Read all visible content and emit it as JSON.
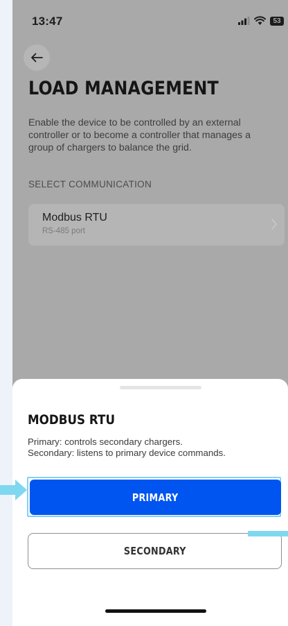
{
  "status_bar": {
    "time": "13:47",
    "battery": "53",
    "icons": [
      "signal-icon",
      "wifi-icon",
      "battery-icon"
    ]
  },
  "header": {
    "back_icon": "arrow-left-icon",
    "title": "LOAD MANAGEMENT",
    "description": "Enable the device to be controlled by an external controller or to become a controller that manages a group of chargers to balance the grid."
  },
  "communication": {
    "section_label": "SELECT COMMUNICATION",
    "option": {
      "title": "Modbus RTU",
      "subtitle": "RS-485 port",
      "icon": "chevron-right-icon"
    }
  },
  "sheet": {
    "title": "MODBUS RTU",
    "description_line1": "Primary: controls secondary chargers.",
    "description_line2": "Secondary: listens to primary device commands.",
    "primary_label": "PRIMARY",
    "secondary_label": "SECONDARY"
  },
  "colors": {
    "accent": "#0055f0",
    "highlight": "#7fd3ee",
    "backdrop": "#a9a9a9"
  }
}
